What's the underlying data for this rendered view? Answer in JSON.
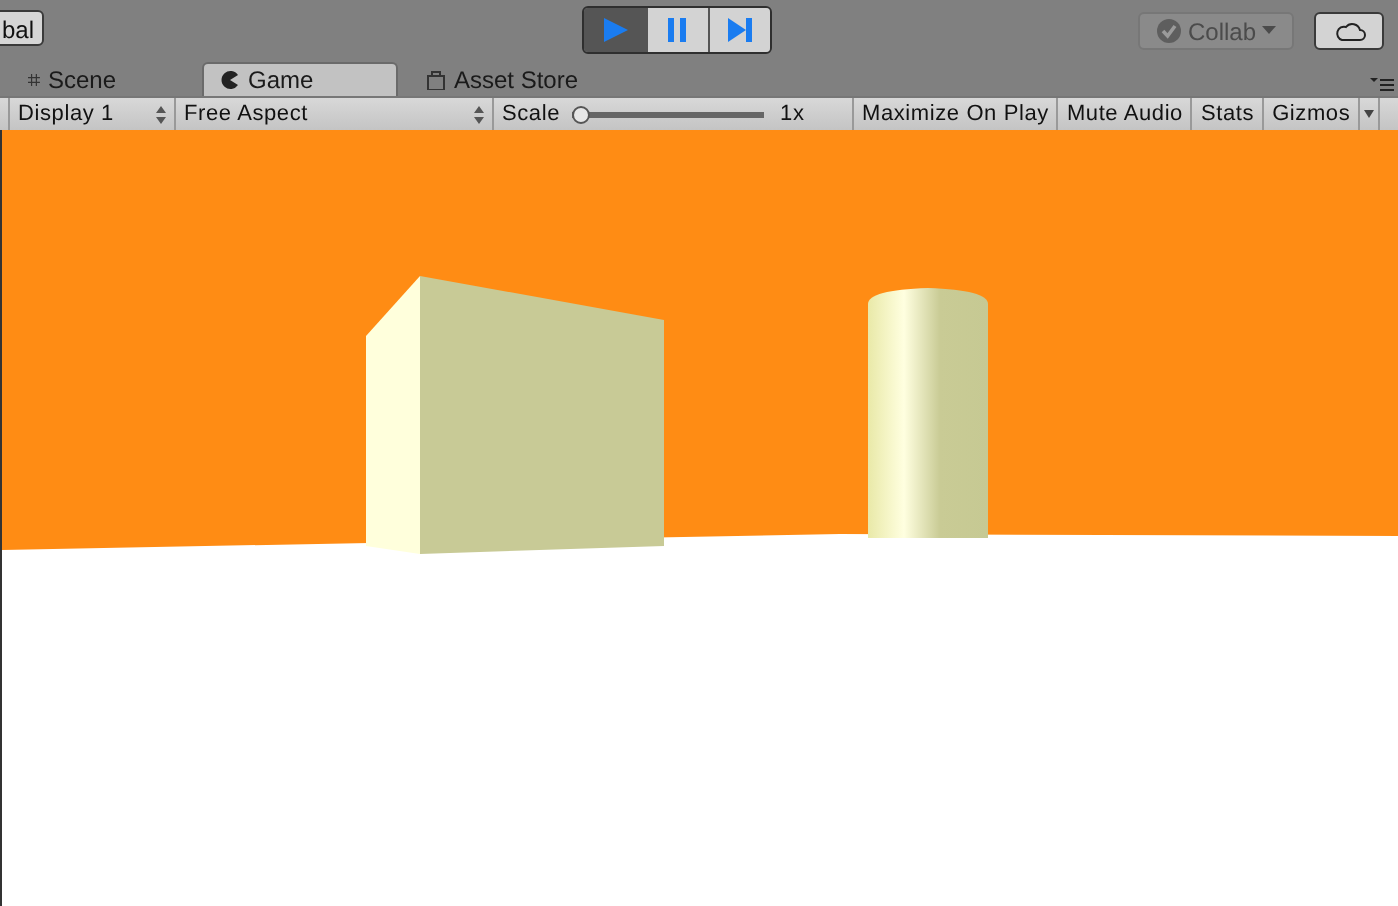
{
  "toolbar": {
    "left_button": "bal",
    "play_buttons": [
      {
        "kind": "play",
        "on": true
      },
      {
        "kind": "pause",
        "on": false
      },
      {
        "kind": "step",
        "on": false
      }
    ],
    "collab": "Collab"
  },
  "tabs": [
    {
      "label": "Scene",
      "kind": "scene",
      "selected": false
    },
    {
      "label": "Game",
      "kind": "game",
      "selected": true
    },
    {
      "label": "Asset Store",
      "kind": "store",
      "selected": false
    }
  ],
  "game_toolbar": {
    "display": "Display 1",
    "aspect": "Free Aspect",
    "scale_label": "Scale",
    "scale": {
      "level": 0
    },
    "scale_value": "1x",
    "toggles": [
      {
        "label": "Maximize On Play",
        "on": false
      },
      {
        "label": "Mute Audio",
        "on": false
      },
      {
        "label": "Stats",
        "on": false
      },
      {
        "label": "Gizmos",
        "on": false
      }
    ]
  }
}
